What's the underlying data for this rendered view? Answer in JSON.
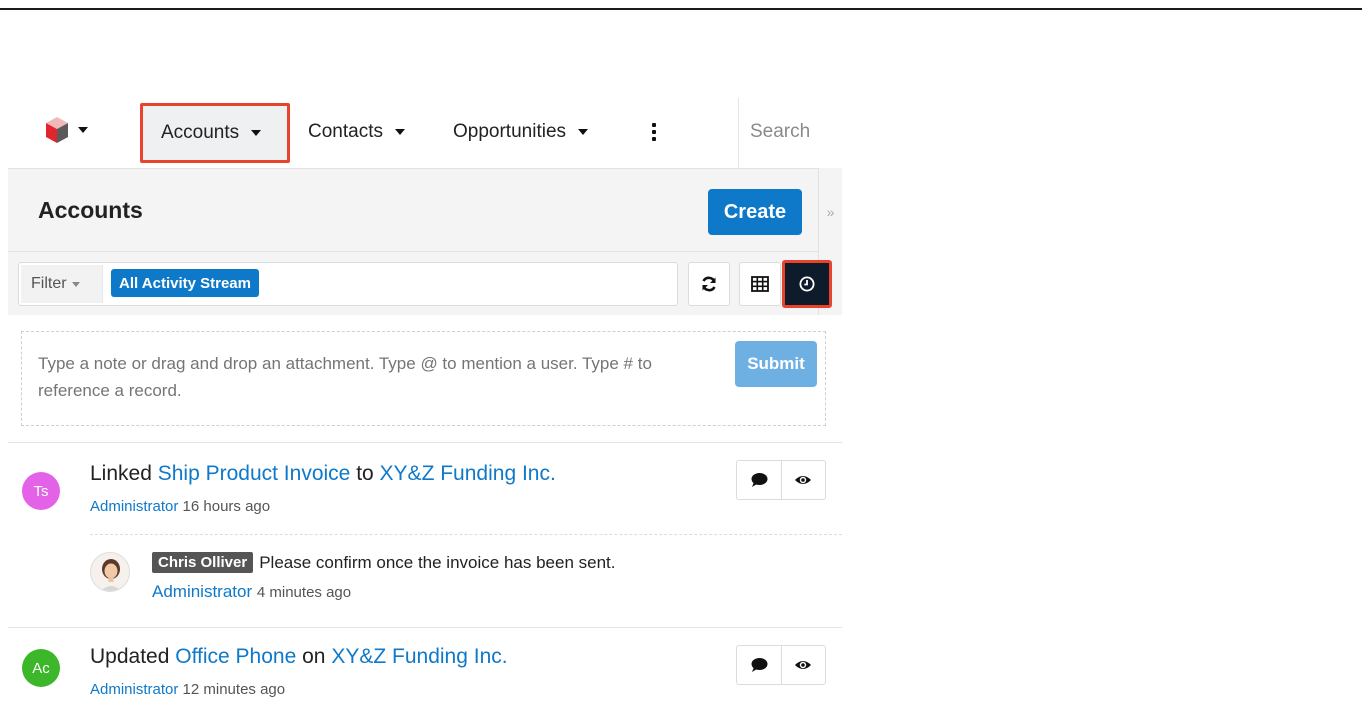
{
  "nav": {
    "items": [
      {
        "label": "Accounts"
      },
      {
        "label": "Contacts"
      },
      {
        "label": "Opportunities"
      }
    ],
    "search_placeholder": "Search"
  },
  "header": {
    "title": "Accounts",
    "create_label": "Create"
  },
  "filter": {
    "label": "Filter",
    "active_filter": "All Activity Stream"
  },
  "composer": {
    "placeholder": "Type a note or drag and drop an attachment. Type @ to mention a user. Type # to reference a record.",
    "submit_label": "Submit"
  },
  "activities": [
    {
      "avatar": "Ts",
      "avatar_color": "#e462e8",
      "verb": "Linked",
      "link1": "Ship Product Invoice",
      "connector": "to",
      "link2": "XY&Z Funding Inc.",
      "trailing": ".",
      "user": "Administrator",
      "time": "16 hours ago",
      "comment": {
        "mention": "Chris Olliver",
        "text": "Please confirm once the invoice has been sent.",
        "user": "Administrator",
        "time": "4 minutes ago"
      }
    },
    {
      "avatar": "Ac",
      "avatar_color": "#3cb72a",
      "verb": "Updated",
      "link1": "Office Phone",
      "connector": "on",
      "link2": "XY&Z Funding Inc.",
      "trailing": ".",
      "user": "Administrator",
      "time": "12 minutes ago"
    }
  ],
  "colors": {
    "accent": "#0f79c9",
    "highlight_border": "#e8432d",
    "activity_button_bg": "#0d1b2a"
  },
  "icons": {
    "logo": "sugar-cube-logo",
    "refresh": "refresh-icon",
    "list_view": "list-view-icon",
    "activity_stream": "clock-icon",
    "comment": "comment-bubble-icon",
    "follow": "eye-icon"
  }
}
